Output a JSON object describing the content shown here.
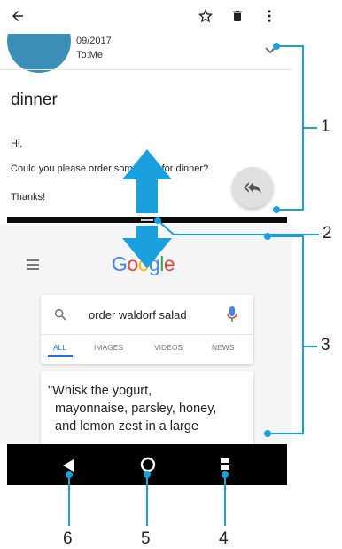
{
  "email": {
    "date": "09/2017",
    "to": "To:Me",
    "subject": "dinner",
    "greeting": "Hi,",
    "body": "Could you please order something for dinner?",
    "signoff": "Thanks!"
  },
  "search": {
    "logo": "Google",
    "query": "order waldorf salad",
    "tabs": [
      "ALL",
      "IMAGES",
      "VIDEOS",
      "NEWS"
    ],
    "active_tab": "ALL",
    "snippet_lines": [
      "\"Whisk the yogurt,",
      "mayonnaise, parsley, honey,",
      "and lemon zest in a large"
    ]
  },
  "callouts": [
    "1",
    "2",
    "3",
    "4",
    "5",
    "6"
  ],
  "colors": {
    "accent": "#1a73e8",
    "callout": "#1aa0dc",
    "avatar": "#3b8fb6",
    "google_blue": "#4285F4",
    "google_red": "#EA4335",
    "google_yellow": "#FBBC05",
    "google_green": "#34A853"
  },
  "icons": {
    "back": "back-arrow-icon",
    "star": "star-icon",
    "delete": "trash-icon",
    "more": "more-vert-icon",
    "reply_all": "reply-all-icon",
    "search": "search-icon",
    "mic": "mic-icon",
    "menu": "hamburger-icon",
    "nav_back": "nav-back-icon",
    "nav_home": "nav-home-icon",
    "nav_recents": "nav-recents-icon"
  }
}
